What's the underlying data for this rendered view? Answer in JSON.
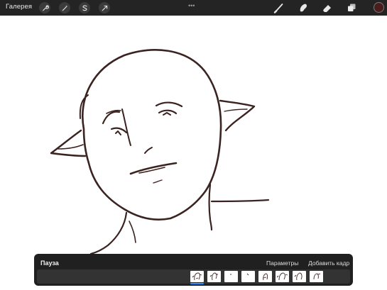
{
  "toolbar": {
    "gallery_label": "Галерея",
    "left_tools": [
      "wrench-icon",
      "magic-wand-icon",
      "selection-icon",
      "transform-arrow-icon"
    ],
    "more_label": "•••",
    "right_tools": [
      "brush-icon",
      "smudge-icon",
      "eraser-icon",
      "layers-icon"
    ],
    "color": "#4a1c1c"
  },
  "animation": {
    "title": "Пауза",
    "settings_label": "Параметры",
    "add_frame_label": "Добавить кадр",
    "frame_count": 8,
    "active_frame_index": 0
  },
  "colors": {
    "toolbar_bg": "#242424",
    "panel_bg": "#202020",
    "stroke": "#3a2320",
    "accent": "#2f8cff"
  }
}
